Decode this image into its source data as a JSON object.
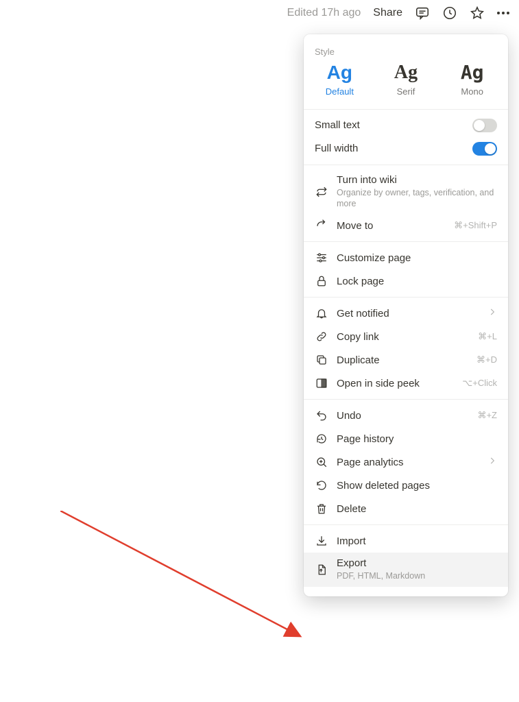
{
  "topbar": {
    "edited": "Edited 17h ago",
    "share": "Share"
  },
  "style": {
    "label": "Style",
    "options": [
      {
        "sample": "Ag",
        "name": "Default"
      },
      {
        "sample": "Ag",
        "name": "Serif"
      },
      {
        "sample": "Ag",
        "name": "Mono"
      }
    ]
  },
  "toggles": {
    "small_text": {
      "label": "Small text",
      "on": false
    },
    "full_width": {
      "label": "Full width",
      "on": true
    }
  },
  "wiki": {
    "title": "Turn into wiki",
    "sub": "Organize by owner, tags, verification, and more"
  },
  "move_to": {
    "label": "Move to",
    "shortcut": "⌘+Shift+P"
  },
  "customize": "Customize page",
  "lock": "Lock page",
  "notified": "Get notified",
  "copy_link": {
    "label": "Copy link",
    "shortcut": "⌘+L"
  },
  "duplicate": {
    "label": "Duplicate",
    "shortcut": "⌘+D"
  },
  "side_peek": {
    "label": "Open in side peek",
    "shortcut": "⌥+Click"
  },
  "undo": {
    "label": "Undo",
    "shortcut": "⌘+Z"
  },
  "page_history": "Page history",
  "page_analytics": "Page analytics",
  "show_deleted": "Show deleted pages",
  "delete": "Delete",
  "import": "Import",
  "export": {
    "label": "Export",
    "sub": "PDF, HTML, Markdown"
  }
}
